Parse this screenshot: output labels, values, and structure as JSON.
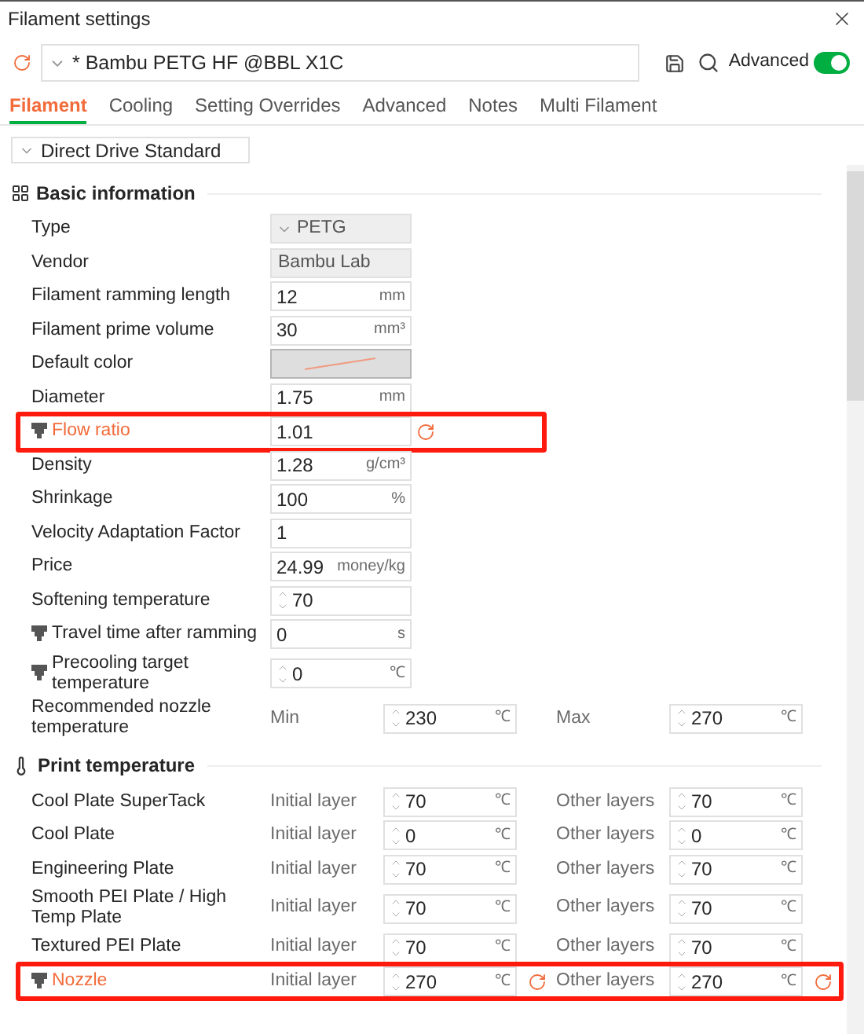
{
  "window": {
    "title": "Filament settings"
  },
  "preset": {
    "value": "* Bambu PETG HF @BBL X1C",
    "modified": true
  },
  "advanced": {
    "label": "Advanced",
    "on": true
  },
  "tabs": [
    {
      "label": "Filament",
      "selected": true
    },
    {
      "label": "Cooling",
      "selected": false
    },
    {
      "label": "Setting Overrides",
      "selected": false
    },
    {
      "label": "Advanced",
      "selected": false
    },
    {
      "label": "Notes",
      "selected": false
    },
    {
      "label": "Multi Filament",
      "selected": false
    }
  ],
  "extruder_select": {
    "value": "Direct Drive Standard"
  },
  "sections": [
    {
      "title": "Basic information",
      "rows": [
        {
          "kind": "select",
          "label": "Type",
          "fields": [
            {
              "value": "PETG"
            }
          ]
        },
        {
          "kind": "readonly",
          "label": "Vendor",
          "fields": [
            {
              "value": "Bambu Lab"
            }
          ]
        },
        {
          "kind": "field",
          "label": "Filament ramming length",
          "fields": [
            {
              "value": "12",
              "unit": "mm"
            }
          ]
        },
        {
          "kind": "field",
          "label": "Filament prime volume",
          "fields": [
            {
              "value": "30",
              "unit": "mm³"
            }
          ]
        },
        {
          "kind": "color",
          "label": "Default color"
        },
        {
          "kind": "field",
          "label": "Diameter",
          "fields": [
            {
              "value": "1.75",
              "unit": "mm"
            }
          ]
        },
        {
          "kind": "field",
          "label": "Flow ratio",
          "modified": true,
          "nozzle_icon": true,
          "highlighted": true,
          "fields": [
            {
              "value": "1.01",
              "modified": true
            }
          ]
        },
        {
          "kind": "field",
          "label": "Density",
          "fields": [
            {
              "value": "1.28",
              "unit": "g/cm³"
            }
          ]
        },
        {
          "kind": "field",
          "label": "Shrinkage",
          "fields": [
            {
              "value": "100",
              "unit": "%"
            }
          ]
        },
        {
          "kind": "field",
          "label": "Velocity Adaptation Factor",
          "fields": [
            {
              "value": "1"
            }
          ]
        },
        {
          "kind": "field",
          "label": "Price",
          "fields": [
            {
              "value": "24.99",
              "unit": "money/kg"
            }
          ]
        },
        {
          "kind": "field",
          "label": "Softening temperature",
          "fields": [
            {
              "value": "70",
              "spin": true
            }
          ]
        },
        {
          "kind": "field",
          "label": "Travel time after ramming",
          "nozzle_icon": true,
          "fields": [
            {
              "value": "0",
              "unit": "s"
            }
          ]
        },
        {
          "kind": "field",
          "label": "Precooling target temperature",
          "nozzle_icon": true,
          "fields": [
            {
              "value": "0",
              "unit": "℃",
              "spin": true
            }
          ]
        },
        {
          "kind": "pair",
          "label": "Recommended nozzle temperature",
          "fields": [
            {
              "label": "Min",
              "value": "230",
              "unit": "℃",
              "spin": true
            },
            {
              "label": "Max",
              "value": "270",
              "unit": "℃",
              "spin": true
            }
          ]
        }
      ]
    },
    {
      "title": "Print temperature",
      "rows": [
        {
          "kind": "pair",
          "label": "Cool Plate SuperTack",
          "fields": [
            {
              "label": "Initial layer",
              "value": "70",
              "unit": "℃",
              "spin": true
            },
            {
              "label": "Other layers",
              "value": "70",
              "unit": "℃",
              "spin": true
            }
          ]
        },
        {
          "kind": "pair",
          "label": "Cool Plate",
          "fields": [
            {
              "label": "Initial layer",
              "value": "0",
              "unit": "℃",
              "spin": true
            },
            {
              "label": "Other layers",
              "value": "0",
              "unit": "℃",
              "spin": true
            }
          ]
        },
        {
          "kind": "pair",
          "label": "Engineering Plate",
          "fields": [
            {
              "label": "Initial layer",
              "value": "70",
              "unit": "℃",
              "spin": true
            },
            {
              "label": "Other layers",
              "value": "70",
              "unit": "℃",
              "spin": true
            }
          ]
        },
        {
          "kind": "pair",
          "label": "Smooth PEI Plate / High Temp Plate",
          "fields": [
            {
              "label": "Initial layer",
              "value": "70",
              "unit": "℃",
              "spin": true
            },
            {
              "label": "Other layers",
              "value": "70",
              "unit": "℃",
              "spin": true
            }
          ]
        },
        {
          "kind": "pair",
          "label": "Textured PEI Plate",
          "fields": [
            {
              "label": "Initial layer",
              "value": "70",
              "unit": "℃",
              "spin": true
            },
            {
              "label": "Other layers",
              "value": "70",
              "unit": "℃",
              "spin": true
            }
          ]
        },
        {
          "kind": "pair",
          "label": "Nozzle",
          "modified": true,
          "nozzle_icon": true,
          "highlighted": true,
          "fields": [
            {
              "label": "Initial layer",
              "value": "270",
              "unit": "℃",
              "spin": true,
              "modified": true
            },
            {
              "label": "Other layers",
              "value": "270",
              "unit": "℃",
              "spin": true,
              "modified": true
            }
          ]
        }
      ]
    }
  ]
}
